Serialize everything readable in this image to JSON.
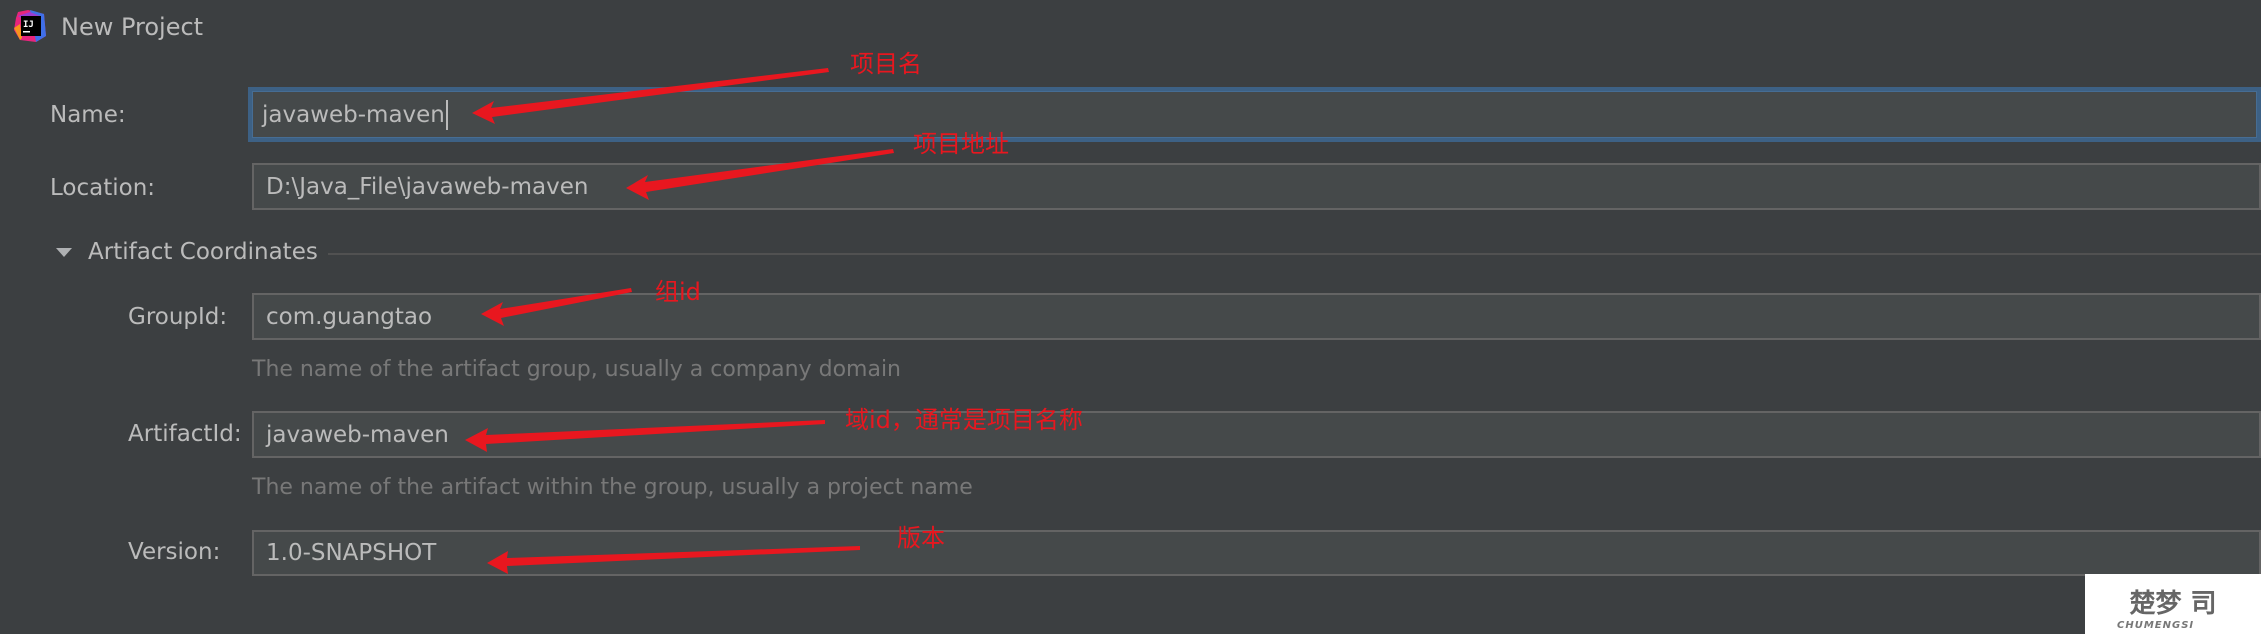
{
  "window": {
    "title": "New Project",
    "logo_icon": "intellij-idea-logo-icon",
    "logo_text": "IJ"
  },
  "form": {
    "name": {
      "label": "Name:",
      "value": "javaweb-maven",
      "focused": true
    },
    "location": {
      "label": "Location:",
      "value": "D:\\Java_File\\javaweb-maven"
    },
    "artifact_section": {
      "title": "Artifact Coordinates",
      "expanded": true,
      "group_id": {
        "label": "GroupId:",
        "value": "com.guangtao",
        "help": "The name of the artifact group, usually a company domain"
      },
      "artifact_id": {
        "label": "ArtifactId:",
        "value": "javaweb-maven",
        "help": "The name of the artifact within the group, usually a project name"
      },
      "version": {
        "label": "Version:",
        "value": "1.0-SNAPSHOT"
      }
    }
  },
  "annotations": [
    {
      "text": "项目名",
      "target": "name"
    },
    {
      "text": "项目地址",
      "target": "location"
    },
    {
      "text": "组id",
      "target": "group_id"
    },
    {
      "text": "域id，通常是项目名称",
      "target": "artifact_id"
    },
    {
      "text": "版本",
      "target": "version"
    }
  ],
  "annotation_color": "#e8171f",
  "watermark": {
    "mark": "楚梦 司",
    "text": "CHUMENGSI"
  }
}
